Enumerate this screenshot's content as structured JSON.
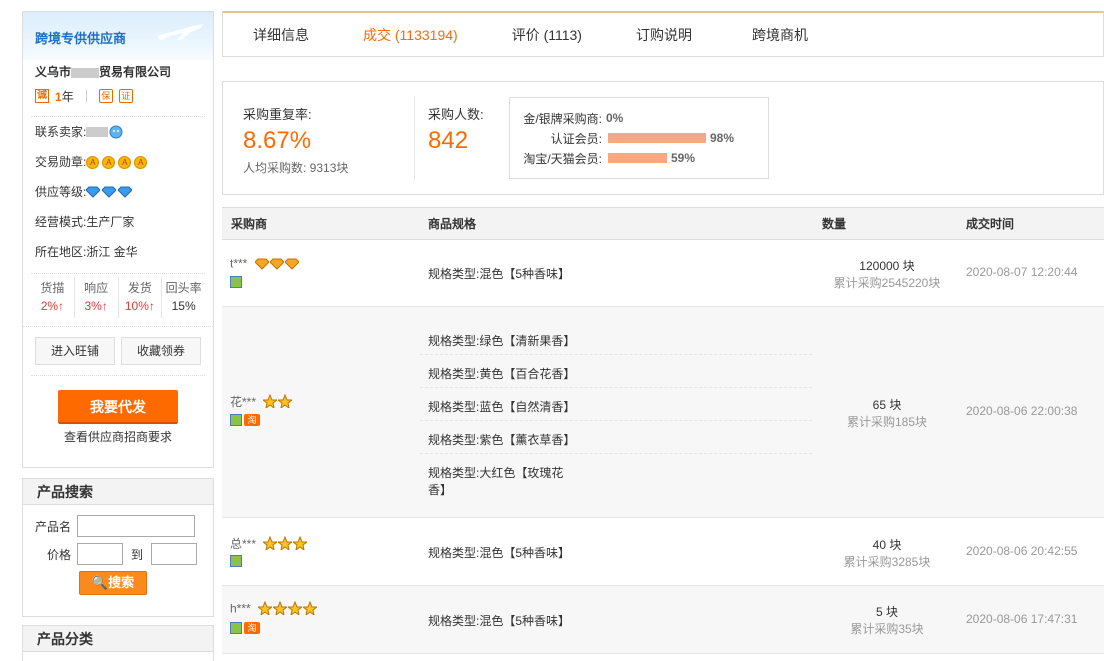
{
  "sidebar": {
    "banner_title": "跨境专供供应商",
    "company_prefix": "义乌市",
    "company_suffix": "贸易有限公司",
    "year_value": "1",
    "year_unit": "年",
    "cheng_icon": "诚",
    "info": {
      "contact_label": "联系卖家:",
      "medal_label": "交易勋章:",
      "level_label": "供应等级:",
      "mode_label": "经营模式:",
      "mode_value": "生产厂家",
      "region_label": "所在地区:",
      "region_value": "浙江 金华"
    },
    "stats": [
      {
        "label": "货描",
        "value": "2%↑"
      },
      {
        "label": "响应",
        "value": "3%↑"
      },
      {
        "label": "发货",
        "value": "10%↑"
      },
      {
        "label": "回头率",
        "value": "15%"
      }
    ],
    "btn_wangpu": "进入旺铺",
    "btn_collect": "收藏领券",
    "daifa_label": "我要代发",
    "daifa_sub": "查看供应商招商要求"
  },
  "search": {
    "title": "产品搜索",
    "name_label": "产品名",
    "price_label": "价格",
    "to_label": "到",
    "button": "搜索"
  },
  "category": {
    "title": "产品分类"
  },
  "tabs": [
    {
      "label": "详细信息"
    },
    {
      "label": "成交 (1133194)"
    },
    {
      "label": "评价 (1113)"
    },
    {
      "label": "订购说明"
    },
    {
      "label": "跨境商机"
    }
  ],
  "summary": {
    "repeat_label": "采购重复率:",
    "repeat_value": "8.67%",
    "avg_label": "人均采购数: 9313块",
    "buyers_label": "采购人数:",
    "buyers_value": "842",
    "dist": [
      {
        "label": "金/银牌采购商:",
        "pct": "0%",
        "fraction": 0
      },
      {
        "label": "认证会员:",
        "pct": "98%",
        "fraction": 0.98
      },
      {
        "label": "淘宝/天猫会员:",
        "pct": "59%",
        "fraction": 0.59
      }
    ]
  },
  "table": {
    "headers": [
      "采购商",
      "商品规格",
      "数量",
      "成交时间"
    ],
    "rows": [
      {
        "buyer": "t***",
        "specs": [
          "规格类型:混色【5种香味】"
        ],
        "qty": "120000 块",
        "total": "累计采购2545220块",
        "time": "2020-08-07 12:20:44"
      },
      {
        "buyer": "花***",
        "specs": [
          "规格类型:绿色【清新果香】",
          "规格类型:黄色【百合花香】",
          "规格类型:蓝色【自然清香】",
          "规格类型:紫色【薰衣草香】",
          "规格类型:大红色【玫瑰花",
          "香】"
        ],
        "qty": "65 块",
        "total": "累计采购185块",
        "time": "2020-08-06 22:00:38"
      },
      {
        "buyer": "总***",
        "specs": [
          "规格类型:混色【5种香味】"
        ],
        "qty": "40 块",
        "total": "累计采购3285块",
        "time": "2020-08-06 20:42:55"
      },
      {
        "buyer": "h***",
        "specs": [
          "规格类型:混色【5种香味】"
        ],
        "qty": "5 块",
        "total": "累计采购35块",
        "time": "2020-08-06 17:47:31"
      }
    ]
  },
  "colors": {
    "accent": "#ff6a00",
    "bar": "#f7a882",
    "link_blue": "#1f6fc6"
  }
}
